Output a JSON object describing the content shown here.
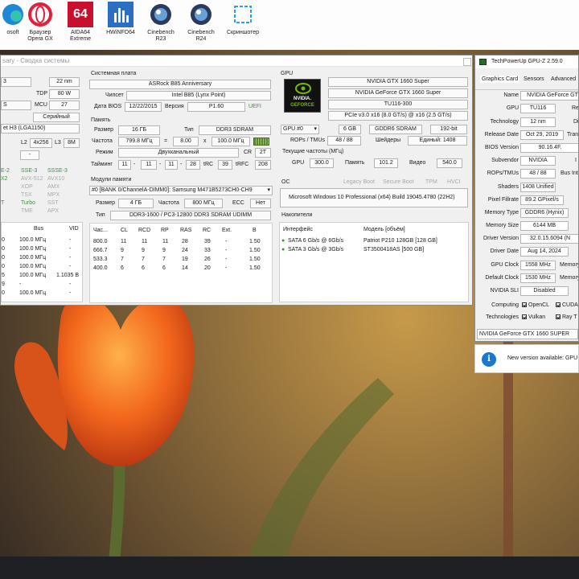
{
  "desktop": {
    "icons": [
      {
        "label": "osoft",
        "label2": ""
      },
      {
        "label": "Браузер",
        "label2": "Opera GX"
      },
      {
        "label": "AIDA64",
        "label2": "Extreme",
        "badge": "64"
      },
      {
        "label": "HWiNFO64",
        "label2": ""
      },
      {
        "label": "Cinebench",
        "label2": "R23"
      },
      {
        "label": "Cinebench",
        "label2": "R24"
      },
      {
        "label": "Скриншотер",
        "label2": ""
      }
    ]
  },
  "hwinfo": {
    "title": "sary - Сводка системы",
    "cpu": {
      "r1a": "3",
      "r1b": "22 nm",
      "r2b": "80 W",
      "r3a": "S",
      "r3b": "27",
      "l_tdp": "TDP",
      "l_mcu": "MCU",
      "serial": "Серийный",
      "socket": "et H3 (LGA1150)",
      "l2": "L2",
      "l2v": "4x256",
      "l3": "L3",
      "l3v": "8M",
      "dash": "-"
    },
    "features": [
      [
        "E-2",
        "SSE-3",
        "SSSE-3"
      ],
      [
        "X2",
        "AVX-512",
        "AVX10"
      ],
      [
        "",
        "XOP",
        "AMX"
      ],
      [
        "",
        "TSX",
        "MPX"
      ],
      [
        "T",
        "Turbo",
        "SST"
      ],
      [
        "",
        "TME",
        "APX"
      ]
    ],
    "cpu_table": {
      "h_bus": "Bus",
      "h_vid": "VID",
      "rows": [
        [
          "0",
          "100.0 МГц",
          "-"
        ],
        [
          "0",
          "100.0 МГц",
          "-"
        ],
        [
          "0",
          "100.0 МГц",
          "-"
        ],
        [
          "0",
          "100.0 МГц",
          "-"
        ],
        [
          "5",
          "100.0 МГц",
          "1.1035 В"
        ],
        [
          "9",
          "-",
          "-"
        ],
        [
          "0",
          "100.0 МГц",
          "-"
        ],
        [
          "0",
          "100.0 МГц",
          "-"
        ]
      ]
    },
    "mb": {
      "header": "Системная плата",
      "name": "ASRock B85 Anniversary",
      "l_chipset": "Чипсет",
      "chipset": "Intel B85 (Lynx Point)",
      "l_bios": "Дата BIOS",
      "bios_date": "12/22/2015",
      "l_version": "Версия",
      "version": "P1.60",
      "uefi": "UEFI"
    },
    "mem": {
      "header": "Память",
      "l_size": "Размер",
      "size": "16 ГБ",
      "l_type": "Тип",
      "type": "DDR3 SDRAM",
      "l_freq": "Частота",
      "freq": "799.8 МГц",
      "eq": "=",
      "mult": "8.00",
      "x": "x",
      "base": "100.0 МГц",
      "l_mode": "Режим",
      "mode": "Двухканальный",
      "l_cr": "CR",
      "cr": "2T",
      "l_timings": "Тайминг",
      "t1": "11",
      "t2": "11",
      "t3": "11",
      "t4": "28",
      "l_trc": "tRC",
      "trc": "39",
      "l_trfc": "tRFC",
      "trfc": "208"
    },
    "modules": {
      "header": "Модули памяти",
      "select": "#0 [BANK 0/ChannelA-DIMM0]: Samsung M471B5273CH0-CH9",
      "l_size": "Размер",
      "size": "4 ГБ",
      "l_freq": "Частота",
      "freq": "800 МГц",
      "l_ecc": "ECC",
      "ecc": "Нет",
      "l_type": "Тип",
      "type": "DDR3-1600 / PC3-12800 DDR3 SDRAM UDIMM",
      "cols": [
        "Час...",
        "CL",
        "RCD",
        "RP",
        "RAS",
        "RC",
        "Ext.",
        "В"
      ],
      "rows": [
        [
          "800.0",
          "11",
          "11",
          "11",
          "28",
          "39",
          "-",
          "1.50"
        ],
        [
          "666.7",
          "9",
          "9",
          "9",
          "24",
          "33",
          "-",
          "1.50"
        ],
        [
          "533.3",
          "7",
          "7",
          "7",
          "19",
          "26",
          "-",
          "1.50"
        ],
        [
          "400.0",
          "6",
          "6",
          "6",
          "14",
          "20",
          "-",
          "1.50"
        ]
      ]
    },
    "gpu": {
      "header": "GPU",
      "name1": "NVIDIA GTX 1660 Super",
      "name2": "NVIDIA GeForce GTX 1660 Super",
      "chip": "TU116-300",
      "pcie": "PCIe v3.0 x16 (8.0 GT/s) @ x16 (2.5 GT/s)",
      "select": "GPU #0",
      "vram": "6 GB",
      "vtype": "GDDR6 SDRAM",
      "bus": "192-bit",
      "l_rops": "ROPs / TMUs",
      "rops": "48 / 88",
      "l_shaders": "Шейдеры",
      "shaders": "Единый: 1408",
      "clocks_header": "Текущие частоты (МГц)",
      "l_gpu": "GPU",
      "gpu_clk": "300.0",
      "l_mem": "Память",
      "mem_clk": "101.2",
      "l_vid": "Видео",
      "vid_clk": "540.0",
      "logo1": "NVIDIA.",
      "logo2": "GEFORCE"
    },
    "os": {
      "header": "ОС",
      "legacy": "Legacy Boot",
      "secure": "Secure Boot",
      "tpm": "TPM",
      "hvci": "HVCI",
      "value": "Microsoft Windows 10 Professional (x64) Build 19045.4780 (22H2)"
    },
    "drives": {
      "header": "Накопители",
      "h_iface": "Интерфейс",
      "h_model": "Модель [объём]",
      "rows": [
        [
          "SATA 6 Gb/s @ 6Gb/s",
          "Patriot P210 128GB [128 GB]"
        ],
        [
          "SATA 3 Gb/s @ 3Gb/s",
          "ST3500418AS [500 GB]"
        ]
      ]
    }
  },
  "gpuz": {
    "title": "TechPowerUp GPU-Z 2.59.0",
    "tabs": [
      "Graphics Card",
      "Sensors",
      "Advanced"
    ],
    "rows": [
      {
        "label": "Name",
        "value": "NVIDIA GeForce GT",
        "extra": ""
      },
      {
        "label": "GPU",
        "value": "TU116",
        "extra": "Re"
      },
      {
        "label": "Technology",
        "value": "12 nm",
        "extra": "Di"
      },
      {
        "label": "Release Date",
        "value": "Oct 29, 2019",
        "extra": "Tran"
      },
      {
        "label": "BIOS Version",
        "value": "90.16.4F.",
        "extra": ""
      },
      {
        "label": "Subvendor",
        "value": "NVIDIA",
        "extra": "I"
      },
      {
        "label": "ROPs/TMUs",
        "value": "48 / 88",
        "extra": "Bus Int"
      },
      {
        "label": "Shaders",
        "value": "1408 Unified",
        "extra": ""
      },
      {
        "label": "Pixel Fillrate",
        "value": "89.2 GPixel/s",
        "extra": ""
      },
      {
        "label": "Memory Type",
        "value": "GDDR6 (Hynix)",
        "extra": ""
      },
      {
        "label": "Memory Size",
        "value": "6144 MB",
        "extra": ""
      },
      {
        "label": "Driver Version",
        "value": "32.0.15.6094 (N",
        "extra": ""
      },
      {
        "label": "Driver Date",
        "value": "Aug 14, 2024",
        "extra": ""
      },
      {
        "label": "GPU Clock",
        "value": "1558 MHz",
        "extra": "Memory"
      },
      {
        "label": "Default Clock",
        "value": "1530 MHz",
        "extra": "Memory"
      },
      {
        "label": "NVIDIA SLI",
        "value": "Disabled",
        "extra": ""
      }
    ],
    "computing_label": "Computing",
    "opencl": "OpenCL",
    "cuda": "CUDA",
    "tech_label": "Technologies",
    "vulkan": "Vulkan",
    "raytr": "Ray T",
    "footer": "NVIDIA GeForce GTX 1660 SUPER"
  },
  "notification": {
    "text": "New version available: GPU",
    "icon_text": "i"
  }
}
